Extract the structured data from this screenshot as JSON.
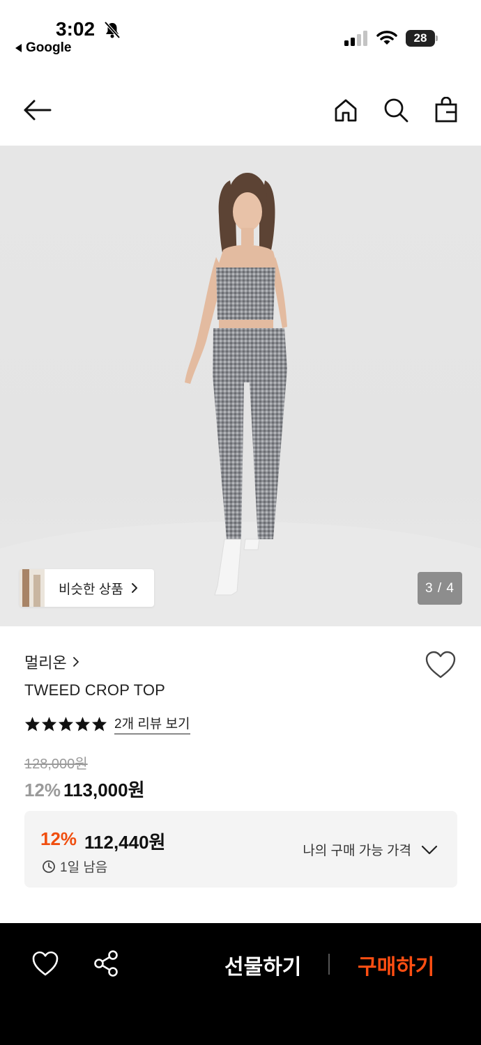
{
  "status_bar": {
    "time": "3:02",
    "back_app": "Google",
    "battery": "28",
    "icons": [
      "bell-off-icon",
      "signal-icon",
      "wifi-icon",
      "battery-icon"
    ]
  },
  "header": {
    "icons": [
      "back-arrow-icon",
      "home-icon",
      "search-icon",
      "shopping-bag-icon"
    ]
  },
  "gallery": {
    "similar_label": "비슷한 상품",
    "page_indicator": "3 / 4",
    "current_page": 3,
    "total_pages": 4
  },
  "product": {
    "brand": "멀리온",
    "name": "TWEED CROP TOP",
    "rating": 5,
    "review_link": "2개 리뷰 보기",
    "original_price": "128,000원",
    "discount": "12%",
    "price": "113,000원"
  },
  "coupon": {
    "discount": "12%",
    "price": "112,440원",
    "time_left": "1일 남음",
    "my_price_label": "나의 구매 가능 가격"
  },
  "bottom_bar": {
    "gift_label": "선물하기",
    "buy_label": "구매하기"
  },
  "colors": {
    "accent": "#f04e0f",
    "bottom_bar": "#000000",
    "coupon_bg": "#f4f4f4"
  }
}
